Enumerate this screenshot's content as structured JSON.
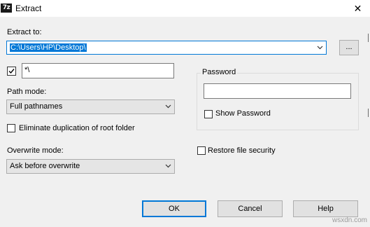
{
  "window": {
    "title": "Extract",
    "app_icon_text": "7z",
    "close_glyph": "✕"
  },
  "extract_to": {
    "label": "Extract to:",
    "path_value": "C:\\Users\\HP\\Desktop\\",
    "browse_label": "..."
  },
  "subfolder": {
    "checked": true,
    "value": "*\\"
  },
  "path_mode": {
    "label": "Path mode:",
    "selected": "Full pathnames"
  },
  "eliminate_duplication": {
    "label": "Eliminate duplication of root folder",
    "checked": false
  },
  "overwrite_mode": {
    "label": "Overwrite mode:",
    "selected": "Ask before overwrite"
  },
  "password": {
    "group_label": "Password",
    "value": "",
    "show_password_label": "Show Password",
    "show_password_checked": false
  },
  "restore_security": {
    "label": "Restore file security",
    "checked": false
  },
  "buttons": {
    "ok": "OK",
    "cancel": "Cancel",
    "help": "Help"
  },
  "watermark": "wsxdn.com",
  "colors": {
    "accent": "#0078d7",
    "dialog_bg": "#f0f0f0"
  }
}
